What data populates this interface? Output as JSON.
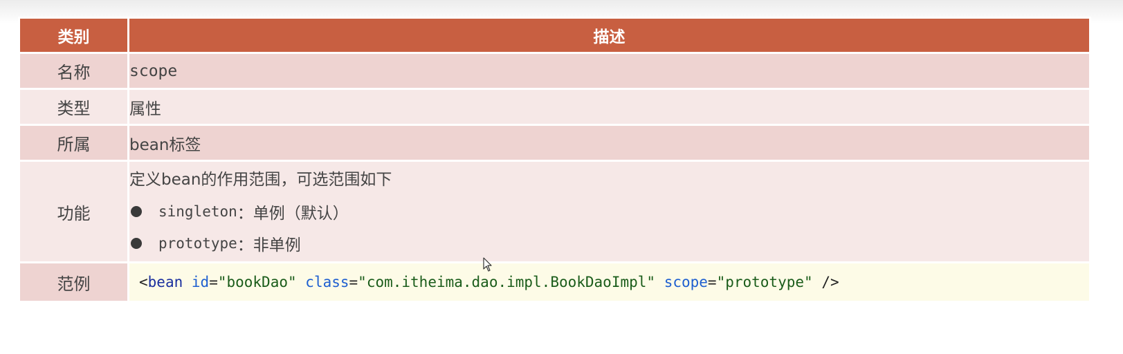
{
  "table": {
    "headers": [
      "类别",
      "描述"
    ],
    "rows": {
      "name": {
        "label": "名称",
        "value": "scope"
      },
      "type": {
        "label": "类型",
        "value": "属性"
      },
      "owner": {
        "label": "所属",
        "value": "bean标签"
      },
      "function": {
        "label": "功能",
        "intro": "定义bean的作用范围，可选范围如下",
        "items": [
          {
            "term": "singleton",
            "desc": "：单例（默认）"
          },
          {
            "term": "prototype",
            "desc": "：非单例"
          }
        ]
      },
      "example": {
        "label": "范例",
        "code": {
          "open": "<",
          "tag": "bean",
          "attr1": "id",
          "eq1": "=",
          "val1": "\"bookDao\"",
          "attr2": "class",
          "eq2": "=",
          "val2": "\"com.itheima.dao.impl.BookDaoImpl\"",
          "attr3": "scope",
          "eq3": "=",
          "val3": "\"prototype\"",
          "close": "/>"
        }
      }
    }
  },
  "colors": {
    "header_bg": "#c85f41",
    "row_dark": "#eed3d1",
    "row_light": "#f6e8e7",
    "code_bg": "#fdfbe7"
  }
}
